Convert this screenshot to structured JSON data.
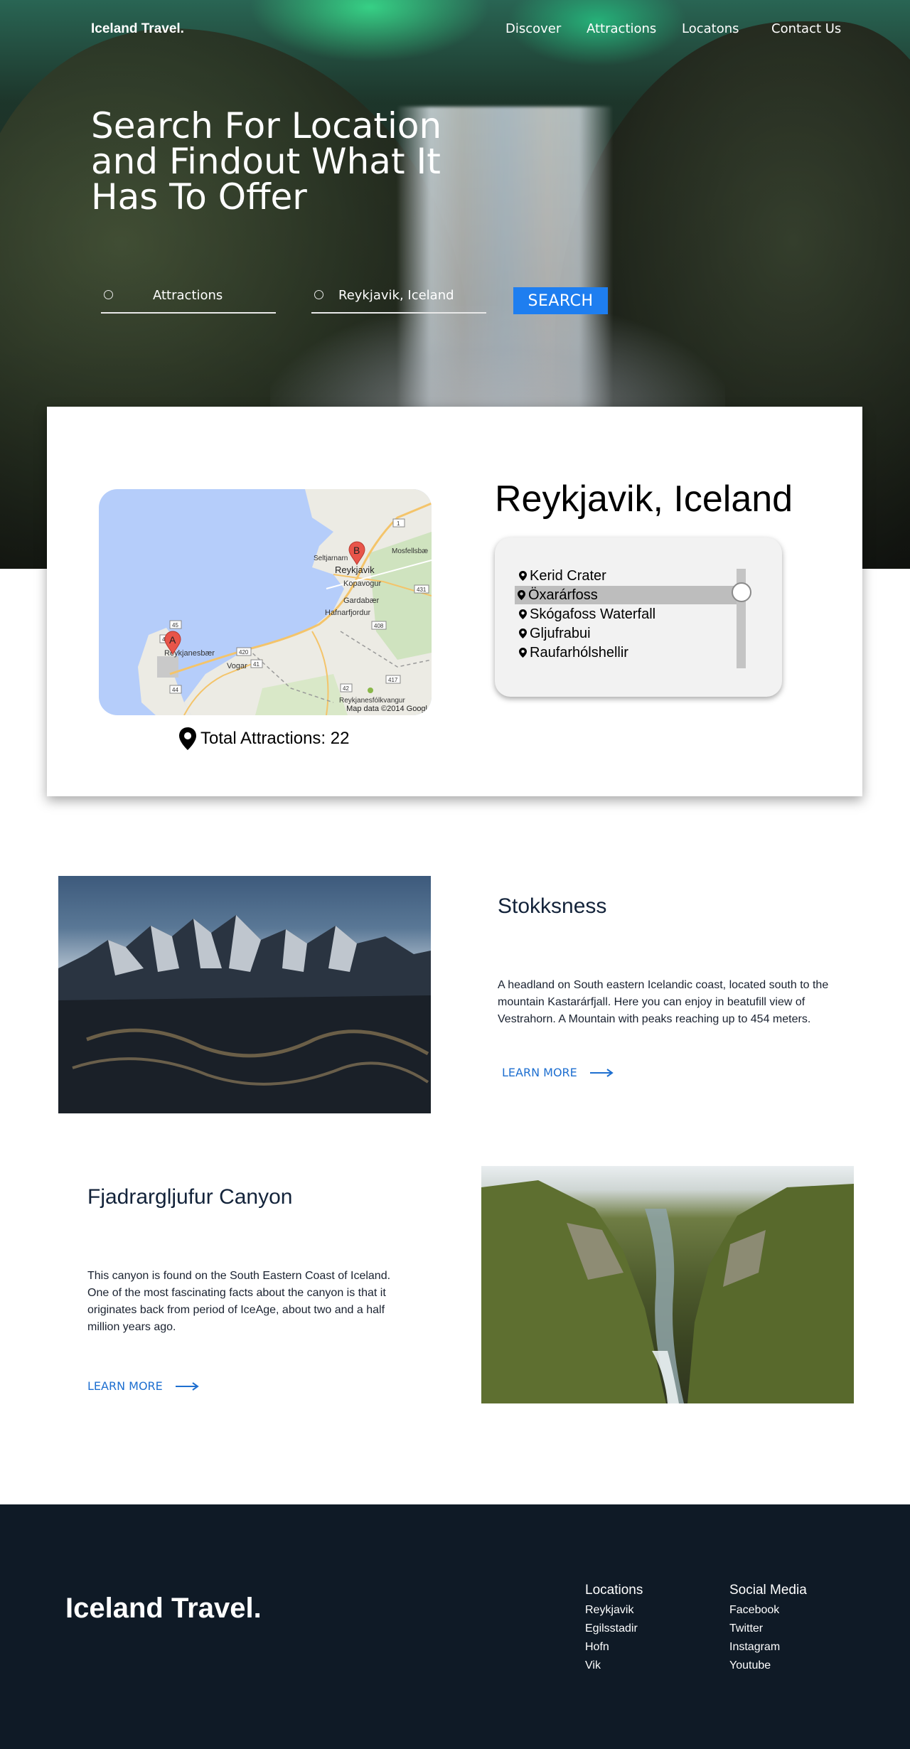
{
  "brand": "Iceland Travel.",
  "nav": {
    "items": [
      "Discover",
      "Attractions",
      "Locatons",
      "Contact Us"
    ]
  },
  "hero": {
    "title": "Search For Location and Findout What It Has To Offer",
    "category_value": "Attractions",
    "location_value": "Reykjavik, Iceland",
    "search_label": "SEARCH"
  },
  "result": {
    "city": "Reykjavik, Iceland",
    "total_attractions": "Total Attractions: 22",
    "map": {
      "labels": [
        "Seltjarnarn",
        "Reykjavik",
        "Kopavogur",
        "Gardabær",
        "Hafnarfjordur",
        "Mosfellsbæ",
        "Reykjanesbær",
        "Vogar",
        "Reykjanesfólkvangur"
      ],
      "road_numbers": [
        "1",
        "431",
        "408",
        "41",
        "420",
        "45",
        "44",
        "42",
        "417",
        "44"
      ],
      "markers": [
        "A",
        "B"
      ],
      "copyright": "Map data ©2014 Googl"
    },
    "attractions": [
      "Kerid Crater",
      "Öxarárfoss",
      "Skógafoss Waterfall",
      "Gljufrabui",
      "Raufarhólshellir"
    ],
    "selected_index": 1
  },
  "features": [
    {
      "title": "Stokksness",
      "description": "A headland on South eastern Icelandic coast, located south to the mountain Kastarárfjall. Here you can enjoy in beatufill view of Vestrahorn. A Mountain with peaks reaching up to 454 meters.",
      "cta": "LEARN MORE"
    },
    {
      "title": "Fjadrargljufur Canyon",
      "description": "This  canyon is found on the South Eastern Coast of Iceland. One of the most fascinating facts about the canyon is that it originates back from period of IceAge, about two and a half million years ago.",
      "cta": "LEARN MORE"
    }
  ],
  "footer": {
    "brand": "Iceland Travel.",
    "locations": {
      "heading": "Locations",
      "links": [
        "Reykjavik",
        "Egilsstadir",
        "Hofn",
        "Vik"
      ]
    },
    "social": {
      "heading": "Social Media",
      "links": [
        "Facebook",
        "Twitter",
        "Instagram",
        "Youtube"
      ]
    }
  },
  "colors": {
    "accent": "#1e7ef0",
    "link": "#1e6fd0",
    "footer_bg": "#0f1a26",
    "heading_dark": "#13233a"
  },
  "icons": [
    "location-pin-icon",
    "radio-ring-icon",
    "arrow-right-icon",
    "map-marker-icon"
  ]
}
